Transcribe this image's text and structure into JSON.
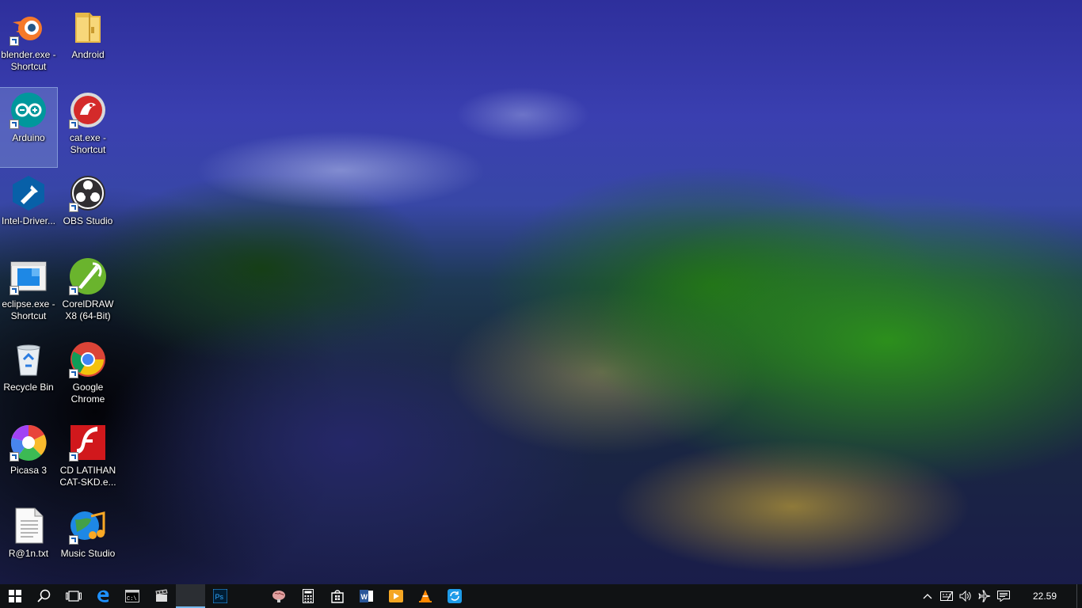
{
  "desktop": {
    "icons": [
      {
        "label": "blender.exe -\nShortcut",
        "icon": "blender-icon",
        "shortcut": true
      },
      {
        "label": "Android",
        "icon": "folder-icon",
        "shortcut": false
      },
      {
        "label": "Arduino",
        "icon": "arduino-icon",
        "shortcut": true,
        "selected": true
      },
      {
        "label": "cat.exe -\nShortcut",
        "icon": "cat-app-icon",
        "shortcut": true
      },
      {
        "label": "Intel-Driver...",
        "icon": "intel-driver-icon",
        "shortcut": false
      },
      {
        "label": "OBS Studio",
        "icon": "obs-icon",
        "shortcut": true
      },
      {
        "label": "eclipse.exe -\nShortcut",
        "icon": "eclipse-window-icon",
        "shortcut": true
      },
      {
        "label": "CorelDRAW\nX8 (64-Bit)",
        "icon": "coreldraw-icon",
        "shortcut": true
      },
      {
        "label": "Recycle Bin",
        "icon": "recycle-bin-icon",
        "shortcut": false
      },
      {
        "label": "Google\nChrome",
        "icon": "chrome-icon",
        "shortcut": true
      },
      {
        "label": "Picasa 3",
        "icon": "picasa-icon",
        "shortcut": true
      },
      {
        "label": "CD LATIHAN\nCAT-SKD.e...",
        "icon": "flash-icon",
        "shortcut": true
      },
      {
        "label": "R@1n.txt",
        "icon": "text-file-icon",
        "shortcut": false
      },
      {
        "label": "Music Studio",
        "icon": "music-studio-icon",
        "shortcut": true
      }
    ]
  },
  "taskbar": {
    "pinned": [
      {
        "name": "start-button",
        "icon": "windows-logo-icon"
      },
      {
        "name": "search-button",
        "icon": "search-icon"
      },
      {
        "name": "task-view-button",
        "icon": "task-view-icon"
      },
      {
        "name": "edge-button",
        "icon": "edge-icon"
      },
      {
        "name": "cmd-button",
        "icon": "command-prompt-icon"
      },
      {
        "name": "movie-maker-button",
        "icon": "clapperboard-icon"
      },
      {
        "name": "file-explorer-button",
        "icon": "folder-icon",
        "active": true
      },
      {
        "name": "photoshop-button",
        "icon": "photoshop-icon",
        "label": "Ps"
      },
      {
        "name": "cat-app-button",
        "icon": "cat-app-icon"
      },
      {
        "name": "brain-app-button",
        "icon": "brain-icon"
      },
      {
        "name": "calculator-button",
        "icon": "calculator-icon"
      },
      {
        "name": "store-button",
        "icon": "store-bag-icon"
      },
      {
        "name": "word-button",
        "icon": "word-icon",
        "label": "W"
      },
      {
        "name": "media-player-button",
        "icon": "play-icon"
      },
      {
        "name": "vlc-button",
        "icon": "vlc-cone-icon"
      },
      {
        "name": "sync-app-button",
        "icon": "sync-icon"
      }
    ],
    "tray": {
      "icons": [
        "chevron-up-icon",
        "keyboard-icon",
        "volume-icon",
        "airplane-mode-icon",
        "action-center-icon"
      ],
      "time": "22.59"
    }
  },
  "colors": {
    "taskbar_bg": "#101214",
    "accent": "#76b9ed",
    "selection": "#a0bee6"
  }
}
